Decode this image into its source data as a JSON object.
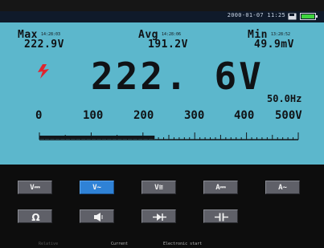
{
  "status": {
    "datetime": "2000-01-07 11:25"
  },
  "stats": {
    "max": {
      "label": "Max",
      "time": "14:28:03",
      "value": "222.9V"
    },
    "avg": {
      "label": "Avg",
      "time": "14:28:06",
      "value": "191.2V"
    },
    "min": {
      "label": "Min",
      "time": "13:28:52",
      "value": "49.9mV"
    }
  },
  "reading": {
    "value": "222. 6V",
    "frequency": "50.0Hz"
  },
  "scale": {
    "ticks": [
      "0",
      "100",
      "200",
      "300",
      "400",
      "500V"
    ],
    "bar_level": 0.445
  },
  "functions": {
    "row1": [
      {
        "label": "V⎓",
        "active": false
      },
      {
        "label": "V~",
        "active": true
      },
      {
        "label": "V≅",
        "active": false
      },
      {
        "label": "A⎓",
        "active": false
      },
      {
        "label": "A~",
        "active": false
      }
    ]
  },
  "footer": {
    "item1": "Relative",
    "item2": "Current",
    "item3": "Electronic start"
  },
  "colors": {
    "lcd": "#5cb7cc",
    "active_button": "#2f82d6",
    "button": "#5f6068",
    "bolt": "#e0242e"
  }
}
